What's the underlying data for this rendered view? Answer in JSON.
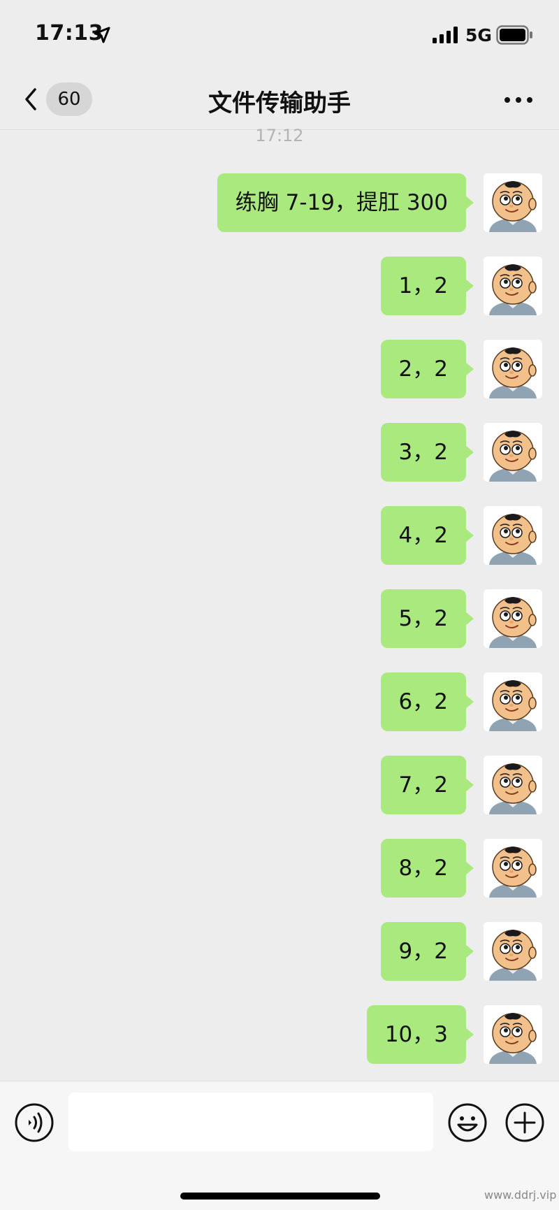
{
  "status_bar": {
    "time": "17:13",
    "network": "5G",
    "icons": [
      "location-arrow-icon",
      "signal-bars-icon",
      "battery-icon"
    ]
  },
  "nav": {
    "unread_count": "60",
    "title": "文件传输助手",
    "icons": [
      "chevron-left-icon",
      "more-dots-icon"
    ]
  },
  "chat": {
    "time_divider": "17:12",
    "messages": [
      {
        "text": "练胸 7-19，提肛 300"
      },
      {
        "text": "1，2"
      },
      {
        "text": "2，2"
      },
      {
        "text": "3，2"
      },
      {
        "text": "4，2"
      },
      {
        "text": "5，2"
      },
      {
        "text": "6，2"
      },
      {
        "text": "7，2"
      },
      {
        "text": "8，2"
      },
      {
        "text": "9，2"
      },
      {
        "text": "10，3"
      }
    ]
  },
  "input_bar": {
    "placeholder": "",
    "icons": [
      "voice-icon",
      "emoji-icon",
      "plus-icon"
    ]
  },
  "colors": {
    "bubble": "#a9e97d",
    "background": "#ededed"
  },
  "watermark": "www.ddrj.vip"
}
